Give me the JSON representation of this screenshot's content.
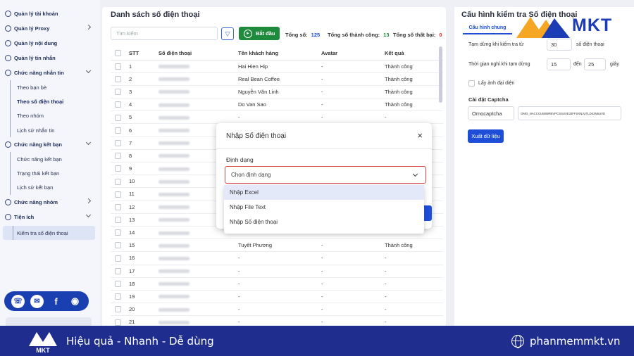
{
  "sidebar": {
    "items": [
      {
        "label": "Quản lý tài khoản",
        "icon": "user-icon"
      },
      {
        "label": "Quản lý Proxy",
        "icon": "globe-icon",
        "chevron": "right"
      },
      {
        "label": "Quản lý nội dung",
        "icon": "content-icon"
      },
      {
        "label": "Quản lý tin nhắn",
        "icon": "message-icon"
      },
      {
        "label": "Chức năng nhắn tin",
        "icon": "chat-icon",
        "chevron": "down"
      }
    ],
    "messaging_sub": [
      "Theo bạn bè",
      "Theo số điện thoại",
      "Theo nhóm",
      "Lịch sử nhắn tin"
    ],
    "friend_item": "Chức năng kết bạn",
    "friend_sub": [
      "Chức năng kết bạn",
      "Trạng thái kết bạn",
      "Lịch sử kết bạn"
    ],
    "group_item": "Chức năng nhóm",
    "util_item": "Tiện ích",
    "util_sub": [
      "Kiểm tra số điện thoại"
    ]
  },
  "main": {
    "title": "Danh sách số điện thoại",
    "search_placeholder": "Tìm kiếm",
    "start_label": "Bắt đầu",
    "stats": [
      {
        "label": "Tổng số:",
        "value": "125",
        "color": "#1e4ed8"
      },
      {
        "label": "Tổng số thành công:",
        "value": "13",
        "color": "#1e8a3c"
      },
      {
        "label": "Tổng số thất bại:",
        "value": "0",
        "color": "#d93030"
      }
    ],
    "columns": [
      "STT",
      "Số điện thoại",
      "Tên khách hàng",
      "Avatar",
      "Kết quả"
    ],
    "rows": [
      {
        "stt": "1",
        "name": "Hai Hien Hip",
        "avatar": "-",
        "result": "Thành công"
      },
      {
        "stt": "2",
        "name": "Real Bean Coffee",
        "avatar": "-",
        "result": "Thành công"
      },
      {
        "stt": "3",
        "name": "Nguyễn Văn Linh",
        "avatar": "-",
        "result": "Thành công"
      },
      {
        "stt": "4",
        "name": "Do Van Sao",
        "avatar": "-",
        "result": "Thành công"
      },
      {
        "stt": "5",
        "name": "-",
        "avatar": "-",
        "result": "-"
      },
      {
        "stt": "6",
        "name": "",
        "avatar": "",
        "result": ""
      },
      {
        "stt": "7",
        "name": "",
        "avatar": "",
        "result": ""
      },
      {
        "stt": "8",
        "name": "",
        "avatar": "",
        "result": ""
      },
      {
        "stt": "9",
        "name": "",
        "avatar": "",
        "result": ""
      },
      {
        "stt": "10",
        "name": "",
        "avatar": "",
        "result": ""
      },
      {
        "stt": "11",
        "name": "",
        "avatar": "",
        "result": ""
      },
      {
        "stt": "12",
        "name": "",
        "avatar": "",
        "result": ""
      },
      {
        "stt": "13",
        "name": "",
        "avatar": "",
        "result": ""
      },
      {
        "stt": "14",
        "name": "",
        "avatar": "",
        "result": ""
      },
      {
        "stt": "15",
        "name": "Tuyết Phương",
        "avatar": "-",
        "result": "Thành công"
      },
      {
        "stt": "16",
        "name": "-",
        "avatar": "-",
        "result": "-"
      },
      {
        "stt": "17",
        "name": "-",
        "avatar": "-",
        "result": "-"
      },
      {
        "stt": "18",
        "name": "-",
        "avatar": "-",
        "result": "-"
      },
      {
        "stt": "19",
        "name": "-",
        "avatar": "-",
        "result": "-"
      },
      {
        "stt": "20",
        "name": "-",
        "avatar": "-",
        "result": "-"
      },
      {
        "stt": "21",
        "name": "-",
        "avatar": "-",
        "result": "-"
      }
    ]
  },
  "modal": {
    "title": "Nhập Số điện thoại",
    "close": "×",
    "format_label": "Định dạng",
    "select_placeholder": "Chọn định dạng",
    "options": [
      "Nhập Excel",
      "Nhập File Text",
      "Nhập Số điện thoại"
    ]
  },
  "right": {
    "title": "Cấu hình kiểm tra Số điện thoại",
    "tab": "Cấu hình chung",
    "pause_label": "Tạm dừng khi kiểm tra từ",
    "pause_value": "30",
    "pause_unit": "số điện thoại",
    "rest_label": "Thời gian nghỉ khi tạm dừng",
    "rest_from": "15",
    "rest_to_label": "đến",
    "rest_to": "25",
    "rest_unit": "giây",
    "avatar_label": "Lấy ảnh đại diện",
    "captcha_section": "Cài đặt Captcha",
    "captcha_provider": "Omocaptcha",
    "captcha_key": "OMO_NACCCUW88R8VPCSSUVE3JFFSXNJUTLD42N6UVD",
    "export_label": "Xuất dữ liệu"
  },
  "brand": {
    "logo_text": "MKT",
    "slogan": "Hiệu quả - Nhanh - Dễ dùng",
    "website": "phanmemmkt.vn",
    "colors": {
      "primary": "#1f2d8e",
      "accent": "#f5a623",
      "success": "#1e8a3c"
    }
  }
}
